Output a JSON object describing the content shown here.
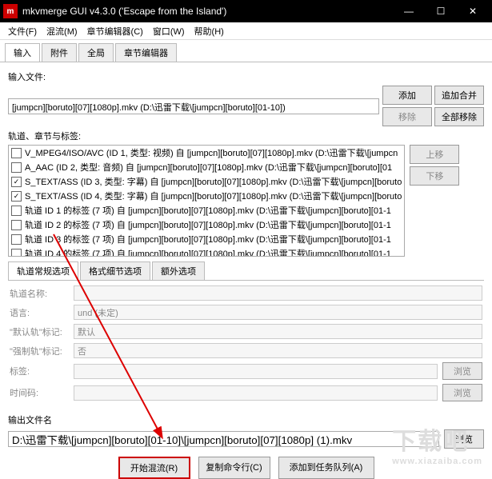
{
  "title": "mkvmerge GUI v4.3.0 ('Escape from the Island')",
  "menu": {
    "file": "文件(F)",
    "muxing": "混流(M)",
    "chapter_editor": "章节编辑器(C)",
    "window": "窗口(W)",
    "help": "帮助(H)"
  },
  "tabs": {
    "input": "输入",
    "attachments": "附件",
    "global": "全局",
    "chapter_editor": "章节编辑器"
  },
  "input_section": {
    "label": "输入文件:",
    "file": "[jumpcn][boruto][07][1080p].mkv (D:\\迅雷下载\\[jumpcn][boruto][01-10])",
    "btn_add": "添加",
    "btn_append": "追加合并",
    "btn_remove": "移除",
    "btn_remove_all": "全部移除"
  },
  "tracks_section": {
    "label": "轨道、章节与标签:",
    "btn_up": "上移",
    "btn_down": "下移",
    "rows": [
      {
        "checked": false,
        "text": "V_MPEG4/ISO/AVC (ID 1, 类型: 视频) 自 [jumpcn][boruto][07][1080p].mkv (D:\\迅雷下载\\[jumpcn"
      },
      {
        "checked": false,
        "text": "A_AAC (ID 2, 类型: 音频) 自 [jumpcn][boruto][07][1080p].mkv (D:\\迅雷下载\\[jumpcn][boruto][01"
      },
      {
        "checked": true,
        "text": "S_TEXT/ASS (ID 3, 类型: 字幕) 自 [jumpcn][boruto][07][1080p].mkv (D:\\迅雷下载\\[jumpcn][boruto"
      },
      {
        "checked": true,
        "text": "S_TEXT/ASS (ID 4, 类型: 字幕) 自 [jumpcn][boruto][07][1080p].mkv (D:\\迅雷下载\\[jumpcn][boruto"
      },
      {
        "checked": false,
        "text": "轨道 ID 1 的标签 (7 项) 自 [jumpcn][boruto][07][1080p].mkv (D:\\迅雷下载\\[jumpcn][boruto][01-1"
      },
      {
        "checked": false,
        "text": "轨道 ID 2 的标签 (7 项) 自 [jumpcn][boruto][07][1080p].mkv (D:\\迅雷下载\\[jumpcn][boruto][01-1"
      },
      {
        "checked": false,
        "text": "轨道 ID 3 的标签 (7 项) 自 [jumpcn][boruto][07][1080p].mkv (D:\\迅雷下载\\[jumpcn][boruto][01-1"
      },
      {
        "checked": false,
        "text": "轨道 ID 4 的标签 (7 项) 自 [jumpcn][boruto][07][1080p].mkv (D:\\迅雷下载\\[jumpcn][boruto][01-1"
      }
    ]
  },
  "subtabs": {
    "general": "轨道常规选项",
    "format": "格式细节选项",
    "extra": "额外选项"
  },
  "form": {
    "track_name": "轨道名称:",
    "language": "语言:",
    "language_val": "und (未定)",
    "default": "\"默认轨\"标记:",
    "default_val": "默认",
    "forced": "\"强制轨\"标记:",
    "forced_val": "否",
    "tags": "标签:",
    "browse": "浏览",
    "timecodes": "时间码:"
  },
  "output": {
    "label": "输出文件名",
    "value": "D:\\迅雷下载\\[jumpcn][boruto][01-10]\\[jumpcn][boruto][07][1080p] (1).mkv",
    "browse": "浏览"
  },
  "bottom": {
    "start": "开始混流(R)",
    "copy": "复制命令行(C)",
    "queue": "添加到任务队列(A)"
  },
  "watermark": {
    "main": "下载吧",
    "sub": "www.xiazaiba.com"
  }
}
